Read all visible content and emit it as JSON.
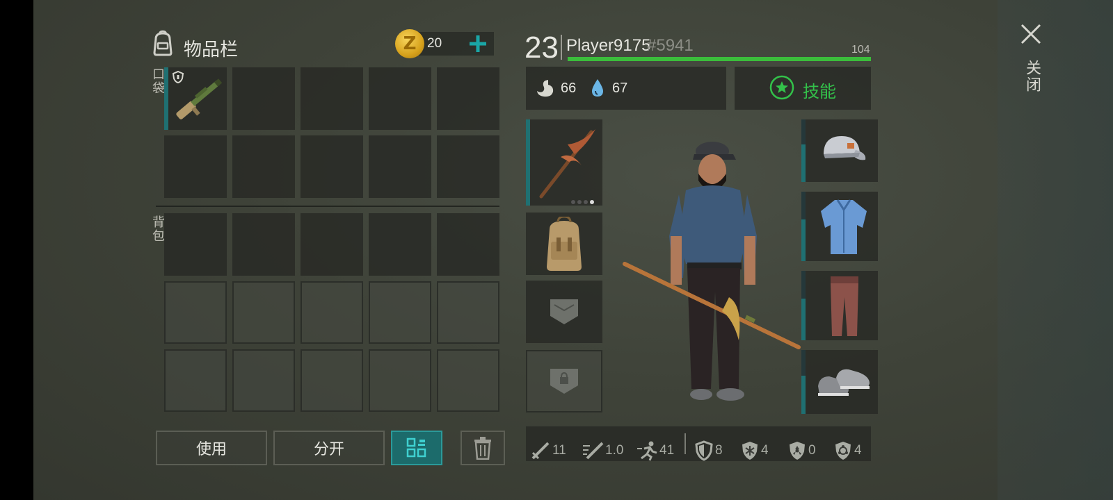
{
  "inventory": {
    "title": "物品栏",
    "pocket_label": "口袋",
    "backpack_label": "背包",
    "coins": "20",
    "coin_symbol": "Z"
  },
  "buttons": {
    "use": "使用",
    "split": "分开"
  },
  "player": {
    "level": "23",
    "name": "Player9175",
    "tag": "#5941",
    "health": "104",
    "health_fraction": 1.0,
    "hunger": "66",
    "thirst": "67",
    "skills_label": "技能"
  },
  "stats": {
    "damage": "11",
    "attack_speed": "1.0",
    "move_speed": "41",
    "armor": "8",
    "cold_resist": "4",
    "radiation_resist": "0",
    "infection_resist": "4"
  },
  "close": {
    "label": "关闭"
  },
  "colors": {
    "accent": "#1aa6a6",
    "health_green": "#3bbd3b",
    "skills_green": "#33c24a",
    "coin_gold": "#e0b020"
  },
  "equipment": {
    "weapon": "pickaxe-icon",
    "backpack": "backpack-icon",
    "cap": "cap-icon",
    "shirt": "shirt-icon",
    "pants": "pants-icon",
    "shoes": "shoes-icon",
    "pocket_item": "shotgun-icon"
  }
}
